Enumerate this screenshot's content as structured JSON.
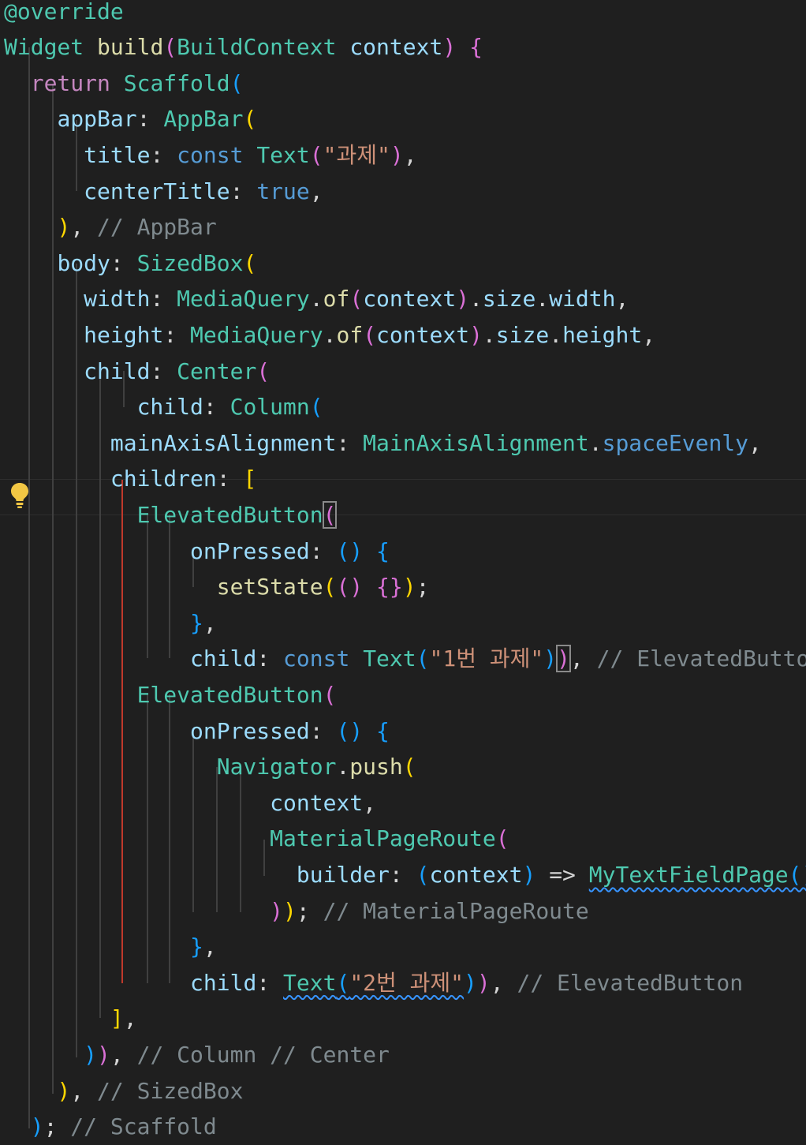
{
  "editor": {
    "theme_colors": {
      "background": "#1f1f1f",
      "keyword": "#c586c0",
      "type": "#4ec9b0",
      "function": "#dcdcaa",
      "property": "#9cdcfe",
      "string": "#ce9178",
      "comment": "#7f8a8f",
      "active_guide": "#c0392b"
    },
    "lightbulb_icon": "lightbulb-icon",
    "lines": [
      [
        {
          "t": "@override",
          "c": "ty"
        }
      ],
      [
        {
          "t": "Widget ",
          "c": "ty"
        },
        {
          "t": "build",
          "c": "fn"
        },
        {
          "t": "(",
          "c": "b2"
        },
        {
          "t": "BuildContext ",
          "c": "ty"
        },
        {
          "t": "context",
          "c": "pr"
        },
        {
          "t": ") ",
          "c": "b2"
        },
        {
          "t": "{",
          "c": "b2"
        }
      ],
      [
        {
          "t": "  "
        },
        {
          "t": "return ",
          "c": "kw"
        },
        {
          "t": "Scaffold",
          "c": "ty"
        },
        {
          "t": "(",
          "c": "b3"
        }
      ],
      [
        {
          "t": "    "
        },
        {
          "t": "appBar",
          "c": "pr"
        },
        {
          "t": ": "
        },
        {
          "t": "AppBar",
          "c": "ty"
        },
        {
          "t": "(",
          "c": "b1"
        }
      ],
      [
        {
          "t": "      "
        },
        {
          "t": "title",
          "c": "pr"
        },
        {
          "t": ": "
        },
        {
          "t": "const ",
          "c": "kw2"
        },
        {
          "t": "Text",
          "c": "ty"
        },
        {
          "t": "(",
          "c": "b2"
        },
        {
          "t": "\"과제\"",
          "c": "st"
        },
        {
          "t": ")",
          "c": "b2"
        },
        {
          "t": ","
        }
      ],
      [
        {
          "t": "      "
        },
        {
          "t": "centerTitle",
          "c": "pr"
        },
        {
          "t": ": "
        },
        {
          "t": "true",
          "c": "kw2"
        },
        {
          "t": ","
        }
      ],
      [
        {
          "t": "    "
        },
        {
          "t": ")",
          "c": "b1"
        },
        {
          "t": ", "
        },
        {
          "t": "// AppBar",
          "c": "cm"
        }
      ],
      [
        {
          "t": "    "
        },
        {
          "t": "body",
          "c": "pr"
        },
        {
          "t": ": "
        },
        {
          "t": "SizedBox",
          "c": "ty"
        },
        {
          "t": "(",
          "c": "b1"
        }
      ],
      [
        {
          "t": "      "
        },
        {
          "t": "width",
          "c": "pr"
        },
        {
          "t": ": "
        },
        {
          "t": "MediaQuery",
          "c": "ty"
        },
        {
          "t": "."
        },
        {
          "t": "of",
          "c": "fn"
        },
        {
          "t": "(",
          "c": "b2"
        },
        {
          "t": "context",
          "c": "pr"
        },
        {
          "t": ")",
          "c": "b2"
        },
        {
          "t": "."
        },
        {
          "t": "size",
          "c": "pr"
        },
        {
          "t": "."
        },
        {
          "t": "width",
          "c": "pr"
        },
        {
          "t": ","
        }
      ],
      [
        {
          "t": "      "
        },
        {
          "t": "height",
          "c": "pr"
        },
        {
          "t": ": "
        },
        {
          "t": "MediaQuery",
          "c": "ty"
        },
        {
          "t": "."
        },
        {
          "t": "of",
          "c": "fn"
        },
        {
          "t": "(",
          "c": "b2"
        },
        {
          "t": "context",
          "c": "pr"
        },
        {
          "t": ")",
          "c": "b2"
        },
        {
          "t": "."
        },
        {
          "t": "size",
          "c": "pr"
        },
        {
          "t": "."
        },
        {
          "t": "height",
          "c": "pr"
        },
        {
          "t": ","
        }
      ],
      [
        {
          "t": "      "
        },
        {
          "t": "child",
          "c": "pr"
        },
        {
          "t": ": "
        },
        {
          "t": "Center",
          "c": "ty"
        },
        {
          "t": "(",
          "c": "b2"
        }
      ],
      [
        {
          "t": "          "
        },
        {
          "t": "child",
          "c": "pr"
        },
        {
          "t": ": "
        },
        {
          "t": "Column",
          "c": "ty"
        },
        {
          "t": "(",
          "c": "b3"
        }
      ],
      [
        {
          "t": "        "
        },
        {
          "t": "mainAxisAlignment",
          "c": "pr"
        },
        {
          "t": ": "
        },
        {
          "t": "MainAxisAlignment",
          "c": "ty"
        },
        {
          "t": "."
        },
        {
          "t": "spaceEvenly",
          "c": "kw2"
        },
        {
          "t": ","
        }
      ],
      [
        {
          "t": "        "
        },
        {
          "t": "children",
          "c": "pr"
        },
        {
          "t": ": "
        },
        {
          "t": "[",
          "c": "b1"
        }
      ],
      [
        {
          "t": "          "
        },
        {
          "t": "ElevatedButton",
          "c": "ty"
        },
        {
          "t": "(",
          "c": "b2",
          "box": true
        }
      ],
      [
        {
          "t": "              "
        },
        {
          "t": "onPressed",
          "c": "pr"
        },
        {
          "t": ": "
        },
        {
          "t": "()",
          "c": "b3"
        },
        {
          "t": " "
        },
        {
          "t": "{",
          "c": "b3"
        }
      ],
      [
        {
          "t": "                "
        },
        {
          "t": "setState",
          "c": "fn"
        },
        {
          "t": "(",
          "c": "b1"
        },
        {
          "t": "()",
          "c": "b2"
        },
        {
          "t": " "
        },
        {
          "t": "{}",
          "c": "b2"
        },
        {
          "t": ")",
          "c": "b1"
        },
        {
          "t": ";"
        }
      ],
      [
        {
          "t": "              "
        },
        {
          "t": "}",
          "c": "b3"
        },
        {
          "t": ","
        }
      ],
      [
        {
          "t": "              "
        },
        {
          "t": "child",
          "c": "pr"
        },
        {
          "t": ": "
        },
        {
          "t": "const ",
          "c": "kw2"
        },
        {
          "t": "Text",
          "c": "ty"
        },
        {
          "t": "(",
          "c": "b3"
        },
        {
          "t": "\"1번 과제\"",
          "c": "st"
        },
        {
          "t": ")",
          "c": "b3"
        },
        {
          "t": ")",
          "c": "b2",
          "box": true
        },
        {
          "t": ", "
        },
        {
          "t": "// ElevatedButton",
          "c": "cm"
        }
      ],
      [
        {
          "t": "          "
        },
        {
          "t": "ElevatedButton",
          "c": "ty"
        },
        {
          "t": "(",
          "c": "b2"
        }
      ],
      [
        {
          "t": "              "
        },
        {
          "t": "onPressed",
          "c": "pr"
        },
        {
          "t": ": "
        },
        {
          "t": "()",
          "c": "b3"
        },
        {
          "t": " "
        },
        {
          "t": "{",
          "c": "b3"
        }
      ],
      [
        {
          "t": "                "
        },
        {
          "t": "Navigator",
          "c": "ty"
        },
        {
          "t": "."
        },
        {
          "t": "push",
          "c": "fn"
        },
        {
          "t": "(",
          "c": "b1"
        }
      ],
      [
        {
          "t": "                    "
        },
        {
          "t": "context",
          "c": "pr"
        },
        {
          "t": ","
        }
      ],
      [
        {
          "t": "                    "
        },
        {
          "t": "MaterialPageRoute",
          "c": "ty"
        },
        {
          "t": "(",
          "c": "b2"
        }
      ],
      [
        {
          "t": "                      "
        },
        {
          "t": "builder",
          "c": "pr"
        },
        {
          "t": ": "
        },
        {
          "t": "(",
          "c": "b3"
        },
        {
          "t": "context",
          "c": "pr"
        },
        {
          "t": ")",
          "c": "b3"
        },
        {
          "t": " => "
        },
        {
          "t": "MyTextFieldPage",
          "c": "ty",
          "sq": true
        },
        {
          "t": "()",
          "c": "b3",
          "sq": true
        },
        {
          "t": ","
        }
      ],
      [
        {
          "t": "                    "
        },
        {
          "t": ")",
          "c": "b2"
        },
        {
          "t": ")",
          "c": "b1"
        },
        {
          "t": "; "
        },
        {
          "t": "// MaterialPageRoute",
          "c": "cm"
        }
      ],
      [
        {
          "t": "              "
        },
        {
          "t": "}",
          "c": "b3"
        },
        {
          "t": ","
        }
      ],
      [
        {
          "t": "              "
        },
        {
          "t": "child",
          "c": "pr"
        },
        {
          "t": ": "
        },
        {
          "t": "Text",
          "c": "ty",
          "sq": true
        },
        {
          "t": "(",
          "c": "b3",
          "sq": true
        },
        {
          "t": "\"2번 과제\"",
          "c": "st",
          "sq": true
        },
        {
          "t": ")",
          "c": "b3"
        },
        {
          "t": ")",
          "c": "b2"
        },
        {
          "t": ", "
        },
        {
          "t": "// ElevatedButton",
          "c": "cm"
        }
      ],
      [
        {
          "t": "        "
        },
        {
          "t": "]",
          "c": "b1"
        },
        {
          "t": ","
        }
      ],
      [
        {
          "t": "      "
        },
        {
          "t": ")",
          "c": "b3"
        },
        {
          "t": ")",
          "c": "b2"
        },
        {
          "t": ", "
        },
        {
          "t": "// Column // Center",
          "c": "cm"
        }
      ],
      [
        {
          "t": "    "
        },
        {
          "t": ")",
          "c": "b1"
        },
        {
          "t": ", "
        },
        {
          "t": "// SizedBox",
          "c": "cm"
        }
      ],
      [
        {
          "t": "  "
        },
        {
          "t": ")",
          "c": "b3"
        },
        {
          "t": "; "
        },
        {
          "t": "// Scaffold",
          "c": "cm"
        }
      ]
    ]
  }
}
